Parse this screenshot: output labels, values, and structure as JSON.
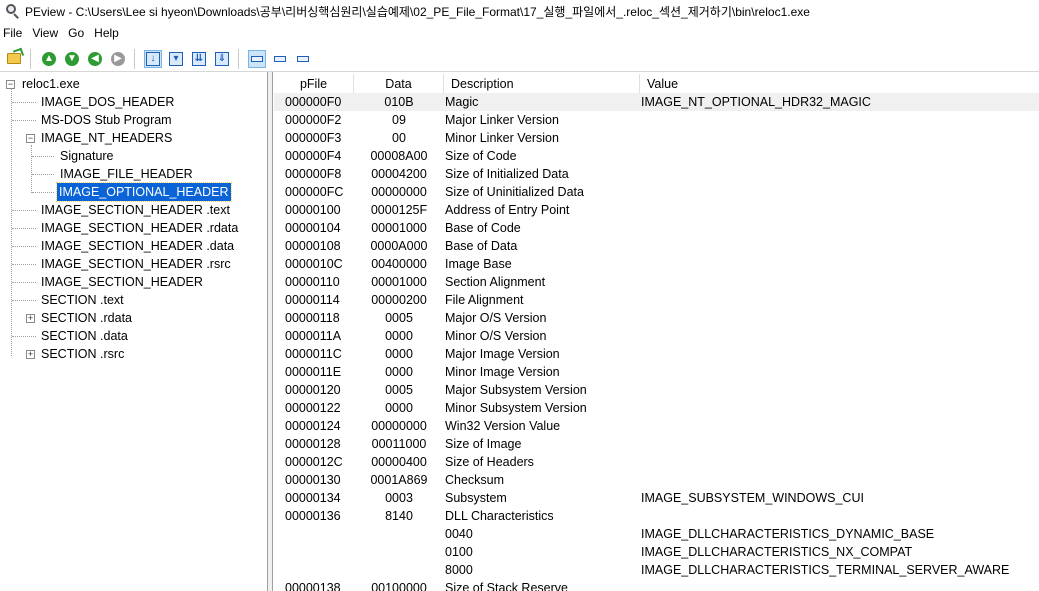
{
  "window": {
    "title": "PEview - C:\\Users\\Lee si hyeon\\Downloads\\공부\\리버싱핵심원리\\실습예제\\02_PE_File_Format\\17_실행_파일에서_.reloc_섹션_제거하기\\bin\\reloc1.exe"
  },
  "menu": [
    "File",
    "View",
    "Go",
    "Help"
  ],
  "toolbar": {
    "icons": [
      "open-file-icon",
      "go-up-icon",
      "go-down-icon",
      "go-back-icon",
      "go-forward-icon",
      "view-byte-icon",
      "view-word-icon",
      "view-dword-icon",
      "view-qword-icon",
      "view-ascii-icon",
      "view-hex-icon",
      "view-dec-icon"
    ]
  },
  "tree": {
    "root": "reloc1.exe",
    "nodes": [
      "IMAGE_DOS_HEADER",
      "MS-DOS Stub Program",
      "IMAGE_NT_HEADERS",
      "Signature",
      "IMAGE_FILE_HEADER",
      "IMAGE_OPTIONAL_HEADER",
      "IMAGE_SECTION_HEADER .text",
      "IMAGE_SECTION_HEADER .rdata",
      "IMAGE_SECTION_HEADER .data",
      "IMAGE_SECTION_HEADER .rsrc",
      "IMAGE_SECTION_HEADER",
      "SECTION .text",
      "SECTION .rdata",
      "SECTION .data",
      "SECTION .rsrc"
    ],
    "selected": "IMAGE_OPTIONAL_HEADER"
  },
  "table": {
    "columns": [
      "pFile",
      "Data",
      "Description",
      "Value"
    ],
    "rows": [
      {
        "pfile": "000000F0",
        "data": "010B",
        "desc": "Magic",
        "value": "IMAGE_NT_OPTIONAL_HDR32_MAGIC"
      },
      {
        "pfile": "000000F2",
        "data": "09",
        "desc": "Major Linker Version",
        "value": ""
      },
      {
        "pfile": "000000F3",
        "data": "00",
        "desc": "Minor Linker Version",
        "value": ""
      },
      {
        "pfile": "000000F4",
        "data": "00008A00",
        "desc": "Size of Code",
        "value": ""
      },
      {
        "pfile": "000000F8",
        "data": "00004200",
        "desc": "Size of Initialized Data",
        "value": ""
      },
      {
        "pfile": "000000FC",
        "data": "00000000",
        "desc": "Size of Uninitialized Data",
        "value": ""
      },
      {
        "pfile": "00000100",
        "data": "0000125F",
        "desc": "Address of Entry Point",
        "value": ""
      },
      {
        "pfile": "00000104",
        "data": "00001000",
        "desc": "Base of Code",
        "value": ""
      },
      {
        "pfile": "00000108",
        "data": "0000A000",
        "desc": "Base of Data",
        "value": ""
      },
      {
        "pfile": "0000010C",
        "data": "00400000",
        "desc": "Image Base",
        "value": ""
      },
      {
        "pfile": "00000110",
        "data": "00001000",
        "desc": "Section Alignment",
        "value": ""
      },
      {
        "pfile": "00000114",
        "data": "00000200",
        "desc": "File Alignment",
        "value": ""
      },
      {
        "pfile": "00000118",
        "data": "0005",
        "desc": "Major O/S Version",
        "value": ""
      },
      {
        "pfile": "0000011A",
        "data": "0000",
        "desc": "Minor O/S Version",
        "value": ""
      },
      {
        "pfile": "0000011C",
        "data": "0000",
        "desc": "Major Image Version",
        "value": ""
      },
      {
        "pfile": "0000011E",
        "data": "0000",
        "desc": "Minor Image Version",
        "value": ""
      },
      {
        "pfile": "00000120",
        "data": "0005",
        "desc": "Major Subsystem Version",
        "value": ""
      },
      {
        "pfile": "00000122",
        "data": "0000",
        "desc": "Minor Subsystem Version",
        "value": ""
      },
      {
        "pfile": "00000124",
        "data": "00000000",
        "desc": "Win32 Version Value",
        "value": ""
      },
      {
        "pfile": "00000128",
        "data": "00011000",
        "desc": "Size of Image",
        "value": ""
      },
      {
        "pfile": "0000012C",
        "data": "00000400",
        "desc": "Size of Headers",
        "value": ""
      },
      {
        "pfile": "00000130",
        "data": "0001A869",
        "desc": "Checksum",
        "value": ""
      },
      {
        "pfile": "00000134",
        "data": "0003",
        "desc": "Subsystem",
        "value": "IMAGE_SUBSYSTEM_WINDOWS_CUI"
      },
      {
        "pfile": "00000136",
        "data": "8140",
        "desc": "DLL Characteristics",
        "value": ""
      },
      {
        "pfile": "",
        "data": "",
        "desc": "0040",
        "value": "IMAGE_DLLCHARACTERISTICS_DYNAMIC_BASE"
      },
      {
        "pfile": "",
        "data": "",
        "desc": "0100",
        "value": "IMAGE_DLLCHARACTERISTICS_NX_COMPAT"
      },
      {
        "pfile": "",
        "data": "",
        "desc": "8000",
        "value": "IMAGE_DLLCHARACTERISTICS_TERMINAL_SERVER_AWARE"
      },
      {
        "pfile": "00000138",
        "data": "00100000",
        "desc": "Size of Stack Reserve",
        "value": ""
      }
    ]
  }
}
